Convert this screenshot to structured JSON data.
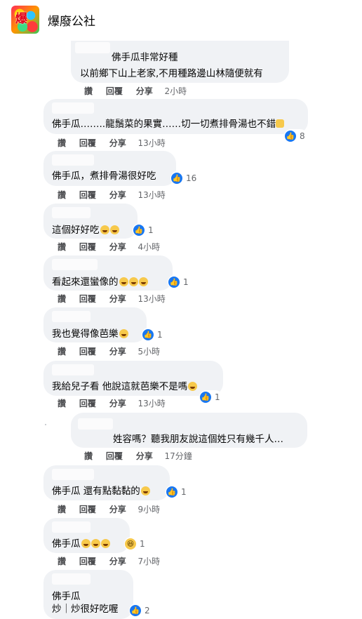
{
  "header": {
    "title": "爆廢公社",
    "logo_text": "爆"
  },
  "comments": [
    {
      "lines": [
        "佛手瓜非常好種",
        "以前鄉下山上老家,不用種路邊山林隨便就有"
      ],
      "actions": [
        "讚",
        "回覆",
        "分享"
      ],
      "time": "2小時",
      "reactions": ""
    },
    {
      "lines": [
        "佛手瓜……..龍鬚菜的果實……切一切煮排骨湯也不錯"
      ],
      "actions": [
        "讚",
        "回覆",
        "分享"
      ],
      "time": "13小時",
      "reactions": "8"
    },
    {
      "lines": [
        "佛手瓜，煮排骨湯很好吃"
      ],
      "actions": [
        "讚",
        "回覆",
        "分享"
      ],
      "time": "13小時",
      "reactions": "16"
    },
    {
      "lines": [
        "這個好好吃"
      ],
      "actions": [
        "讚",
        "回覆",
        "分享"
      ],
      "time": "4小時",
      "reactions": "1"
    },
    {
      "lines": [
        "看起來還蠻像的"
      ],
      "actions": [
        "讚",
        "回覆",
        "分享"
      ],
      "time": "13小時",
      "reactions": "1"
    },
    {
      "lines": [
        "我也覺得像芭樂"
      ],
      "actions": [
        "讚",
        "回覆",
        "分享"
      ],
      "time": "5小時",
      "reactions": "1"
    },
    {
      "lines": [
        "我給兒子看 他說這就芭樂不是嗎"
      ],
      "actions": [
        "讚",
        "回覆",
        "分享"
      ],
      "time": "13小時",
      "reactions": "1"
    },
    {
      "lines": [
        "姓容嗎？聽我朋友說這個姓只有幾千人…"
      ],
      "actions": [
        "讚",
        "回覆",
        "分享"
      ],
      "time": "17分鐘",
      "reactions": ""
    },
    {
      "lines": [
        "佛手瓜 還有點黏黏的"
      ],
      "actions": [
        "讚",
        "回覆",
        "分享"
      ],
      "time": "9小時",
      "reactions": "1"
    },
    {
      "lines": [
        "佛手瓜"
      ],
      "actions": [
        "讚",
        "回覆",
        "分享"
      ],
      "time": "7小時",
      "reactions": "1"
    },
    {
      "lines": [
        "佛手瓜",
        "炒｜炒很好吃喔"
      ],
      "actions": [],
      "time": "",
      "reactions": "2"
    }
  ],
  "colors": {
    "bubble": "#f0f2f5",
    "like": "#1877f2",
    "haha": "#f7c94b",
    "meta": "#65676b"
  },
  "icons": {
    "like": "like-icon",
    "haha": "haha-icon",
    "wow": "wow-icon"
  }
}
